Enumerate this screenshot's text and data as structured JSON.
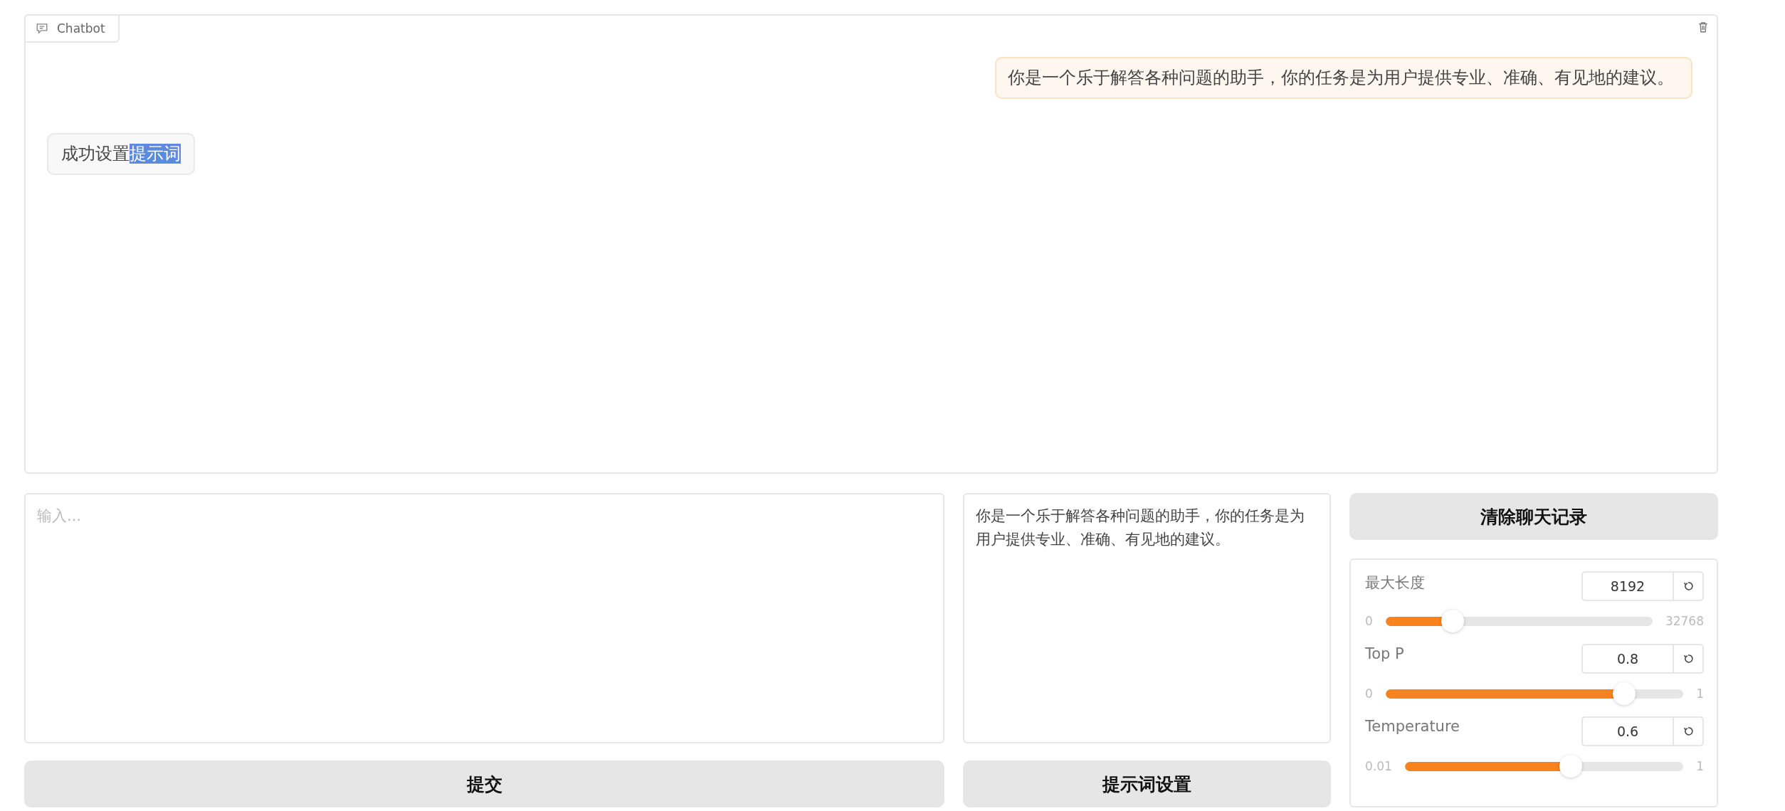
{
  "chatbot": {
    "label": "Chatbot",
    "messages": [
      {
        "kind": "user",
        "segments": [
          {
            "text": "你是一个乐于解答各种问题的助手，你的任务是为用户提供专业、准确、有见地的建议。",
            "selected": false
          }
        ]
      },
      {
        "kind": "bot",
        "segments": [
          {
            "text": "成功设置",
            "selected": false
          },
          {
            "text": "提示词",
            "selected": true
          }
        ]
      }
    ]
  },
  "input": {
    "placeholder": "输入..."
  },
  "submit_button": "提交",
  "system_prompt": {
    "value": "你是一个乐于解答各种问题的助手，你的任务是为用户提供专业、准确、有见地的建议。"
  },
  "prompt_button": "提示词设置",
  "clear_button": "清除聊天记录",
  "sliders": [
    {
      "label": "最大长度",
      "value": "8192",
      "min": "0",
      "max": "32768",
      "level": 0.25
    },
    {
      "label": "Top P",
      "value": "0.8",
      "min": "0",
      "max": "1",
      "level": 0.8
    },
    {
      "label": "Temperature",
      "value": "0.6",
      "min": "0.01",
      "max": "1",
      "level": 0.596
    }
  ]
}
